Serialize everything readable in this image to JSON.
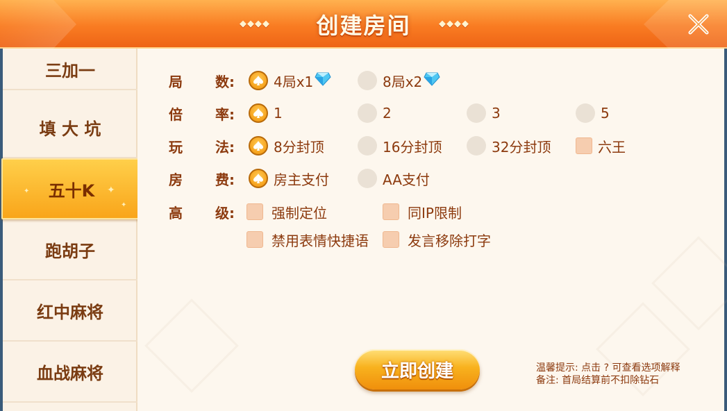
{
  "header": {
    "title": "创建房间",
    "deco_left": "◆◆◆◆",
    "deco_right": "◆◆◆◆"
  },
  "sidebar": {
    "items": [
      {
        "label": "三加一",
        "active": false
      },
      {
        "label": "填 大 坑",
        "active": false
      },
      {
        "label": "五十K",
        "active": true
      },
      {
        "label": "跑胡子",
        "active": false
      },
      {
        "label": "红中麻将",
        "active": false
      },
      {
        "label": "血战麻将",
        "active": false
      }
    ]
  },
  "options": {
    "rounds": {
      "label": [
        "局",
        "数:"
      ],
      "choices": [
        {
          "text": "4局x1",
          "selected": true,
          "gem": true
        },
        {
          "text": "8局x2",
          "selected": false,
          "gem": true
        }
      ]
    },
    "multiplier": {
      "label": [
        "倍",
        "率:"
      ],
      "choices": [
        {
          "text": "1",
          "selected": true
        },
        {
          "text": "2",
          "selected": false
        },
        {
          "text": "3",
          "selected": false
        },
        {
          "text": "5",
          "selected": false
        }
      ]
    },
    "play": {
      "label": [
        "玩",
        "法:"
      ],
      "choices": [
        {
          "text": "8分封顶",
          "selected": true
        },
        {
          "text": "16分封顶",
          "selected": false
        },
        {
          "text": "32分封顶",
          "selected": false
        }
      ],
      "checkbox": {
        "text": "六王",
        "checked": false
      }
    },
    "fee": {
      "label": [
        "房",
        "费:"
      ],
      "choices": [
        {
          "text": "房主支付",
          "selected": true
        },
        {
          "text": "AA支付",
          "selected": false
        }
      ]
    },
    "advanced": {
      "label": [
        "高",
        "级:"
      ],
      "checkboxes": [
        {
          "text": "强制定位",
          "checked": false
        },
        {
          "text": "同IP限制",
          "checked": false
        },
        {
          "text": "禁用表情快捷语",
          "checked": false
        },
        {
          "text": "发言移除打字",
          "checked": false
        }
      ]
    }
  },
  "create_button": "立即创建",
  "tips": {
    "line1": "温馨提示: 点击 ?  可查看选项解释",
    "line2": "备注: 首局结算前不扣除钻石"
  },
  "colors": {
    "header": "#f97c22",
    "active_tab": "#f9a51a",
    "text_brown": "#8c3a0e",
    "panel_bg": "#fdf7ee"
  },
  "icons": {
    "close": "close-x-icon",
    "spade": "spade-icon",
    "gem": "diamond-gem-icon"
  }
}
